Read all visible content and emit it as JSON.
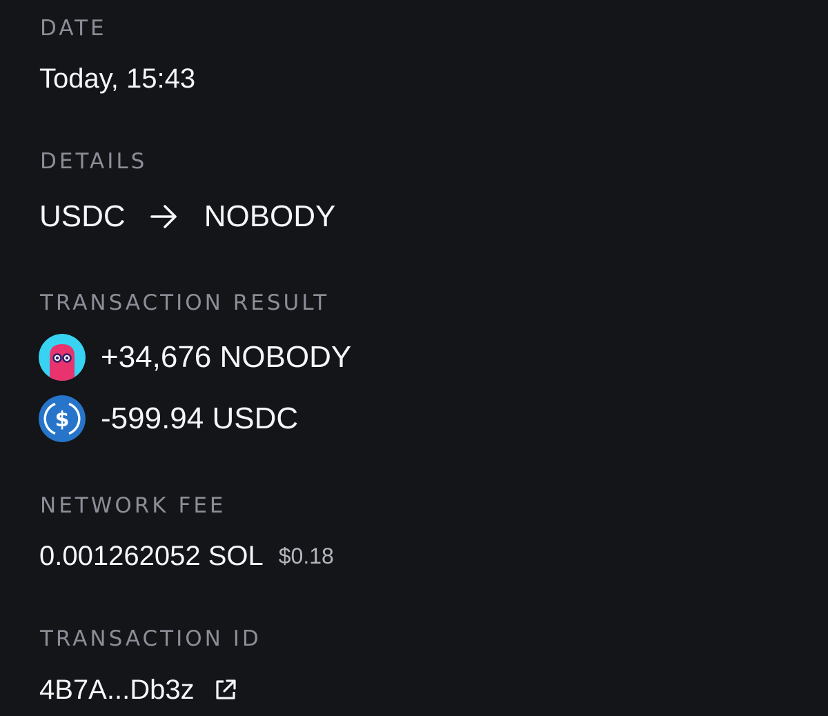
{
  "date": {
    "label": "DATE",
    "value": "Today, 15:43"
  },
  "details": {
    "label": "DETAILS",
    "from_token": "USDC",
    "to_token": "NOBODY",
    "arrow_icon": "arrow-right-icon"
  },
  "transaction_result": {
    "label": "TRANSACTION RESULT",
    "items": [
      {
        "text": "+34,676 NOBODY",
        "icon": "nobody-token-icon",
        "icon_color": "#e8336f"
      },
      {
        "text": "-599.94 USDC",
        "icon": "usdc-token-icon",
        "icon_color": "#2775ca"
      }
    ]
  },
  "network_fee": {
    "label": "NETWORK FEE",
    "amount": "0.001262052 SOL",
    "usd": "$0.18"
  },
  "transaction_id": {
    "label": "TRANSACTION ID",
    "value": "4B7A...Db3z",
    "link_icon": "external-link-icon"
  },
  "colors": {
    "background": "#131519",
    "label": "#8b8e96",
    "text": "#f6f6f8"
  }
}
